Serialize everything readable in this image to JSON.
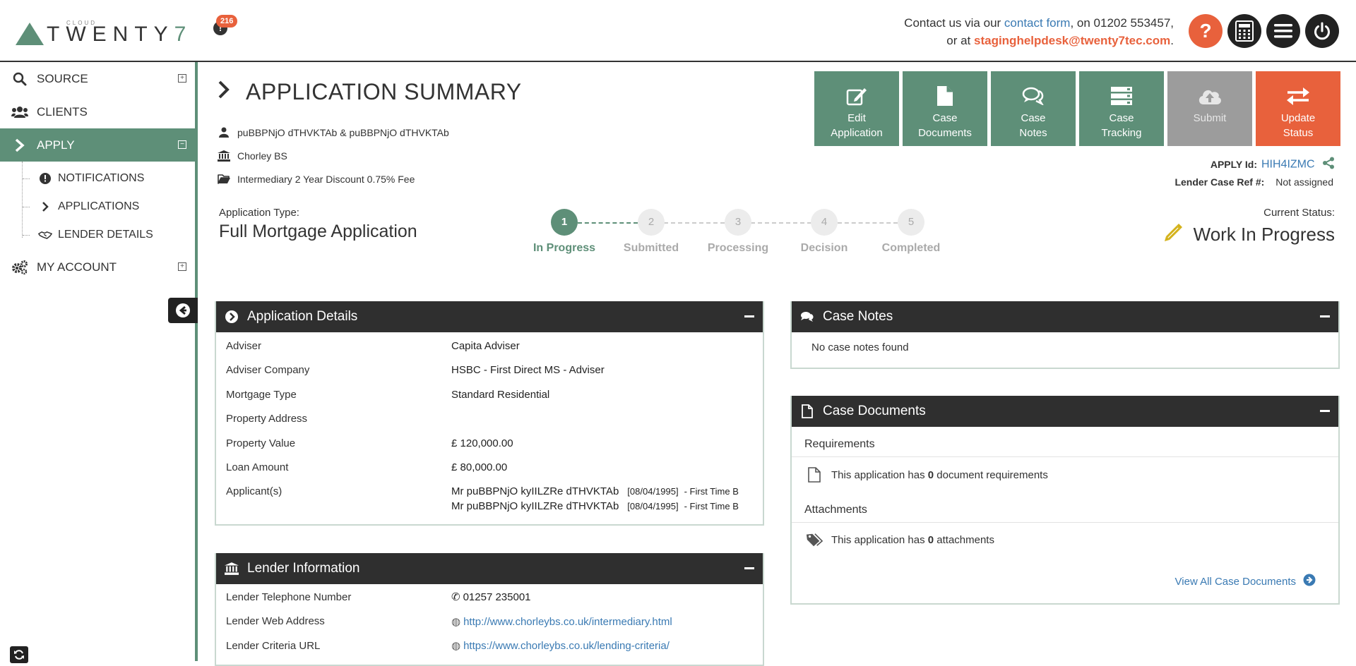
{
  "header": {
    "logo_cloud": "CLOUD",
    "logo_main": "TWENTY",
    "logo_seven": "7",
    "notification_count": "216",
    "contact_prefix": "Contact us via our ",
    "contact_form_link": "contact form",
    "contact_phone_text": ", on 01202 553457,",
    "contact_or": "or at ",
    "contact_email": "staginghelpdesk@twenty7tec.com",
    "contact_end": ".",
    "help_label": "?"
  },
  "sidebar": {
    "source": "SOURCE",
    "clients": "CLIENTS",
    "apply": "APPLY",
    "notifications": "NOTIFICATIONS",
    "applications": "APPLICATIONS",
    "lender_details": "LENDER DETAILS",
    "my_account": "MY ACCOUNT"
  },
  "page": {
    "title": "APPLICATION SUMMARY",
    "applicants_line": "puBBPNjO dTHVKTAb & puBBPNjO dTHVKTAb",
    "lender_line": "Chorley BS",
    "product_line": "Intermediary 2 Year Discount 0.75% Fee",
    "apply_id_label": "APPLY Id:",
    "apply_id_value": "HIH4IZMC",
    "lender_ref_label": "Lender Case Ref #:",
    "lender_ref_value": "Not assigned",
    "app_type_label": "Application Type:",
    "app_type_value": "Full Mortgage Application",
    "current_status_label": "Current Status:",
    "current_status_value": "Work In Progress"
  },
  "actions": {
    "edit": "Edit\nApplication",
    "docs": "Case\nDocuments",
    "notes": "Case\nNotes",
    "tracking": "Case\nTracking",
    "submit": "Submit",
    "update": "Update\nStatus"
  },
  "steps": [
    {
      "num": "1",
      "label": "In Progress"
    },
    {
      "num": "2",
      "label": "Submitted"
    },
    {
      "num": "3",
      "label": "Processing"
    },
    {
      "num": "4",
      "label": "Decision"
    },
    {
      "num": "5",
      "label": "Completed"
    }
  ],
  "app_details": {
    "title": "Application Details",
    "rows": [
      {
        "k": "Adviser",
        "v": "Capita Adviser"
      },
      {
        "k": "Adviser Company",
        "v": "HSBC - First Direct MS - Adviser"
      },
      {
        "k": "Mortgage Type",
        "v": "Standard Residential"
      },
      {
        "k": "Property Address",
        "v": ""
      },
      {
        "k": "Property Value",
        "v": "£ 120,000.00"
      },
      {
        "k": "Loan Amount",
        "v": "£ 80,000.00"
      }
    ],
    "applicants_label": "Applicant(s)",
    "applicants": [
      {
        "name": "Mr puBBPNjO kyIILZRe dTHVKTAb",
        "dob": "[08/04/1995]",
        "type": "- First Time B"
      },
      {
        "name": "Mr puBBPNjO kyIILZRe dTHVKTAb",
        "dob": "[08/04/1995]",
        "type": "- First Time B"
      }
    ]
  },
  "lender_info": {
    "title": "Lender Information",
    "tel_label": "Lender Telephone Number",
    "tel_value": "01257 235001",
    "web_label": "Lender Web Address",
    "web_value": "http://www.chorleybs.co.uk/intermediary.html",
    "criteria_label": "Lender Criteria URL",
    "criteria_value": "https://www.chorleybs.co.uk/lending-criteria/"
  },
  "case_notes": {
    "title": "Case Notes",
    "empty": "No case notes found"
  },
  "case_docs": {
    "title": "Case Documents",
    "req_heading": "Requirements",
    "req_pre": "This application has ",
    "req_count": "0",
    "req_post": " document requirements",
    "att_heading": "Attachments",
    "att_pre": "This application has ",
    "att_count": "0",
    "att_post": " attachments",
    "view_all": "View All Case Documents"
  },
  "colors": {
    "brand_green": "#5e8f78",
    "accent_orange": "#e8613c",
    "link_blue": "#3a7ab3",
    "panel_dark": "#2f2f2f"
  }
}
